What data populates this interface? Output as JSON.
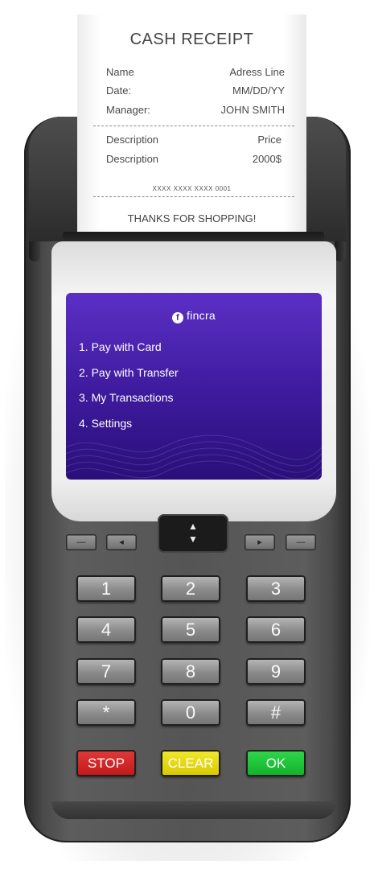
{
  "receipt": {
    "title": "CASH RECEIPT",
    "rows": [
      {
        "label": "Name",
        "value": "Adress Line"
      },
      {
        "label": "Date:",
        "value": "MM/DD/YY"
      },
      {
        "label": "Manager:",
        "value": "JOHN SMITH"
      }
    ],
    "items": [
      {
        "label": "Description",
        "value": "Price"
      },
      {
        "label": "Description",
        "value": "2000$"
      }
    ],
    "card_number": "XXXX XXXX XXXX 0001",
    "thanks": "THANKS FOR SHOPPING!"
  },
  "screen": {
    "brand": "fincra",
    "brand_mark": "f",
    "menu": [
      {
        "label": "1. Pay with Card"
      },
      {
        "label": "2. Pay with Transfer"
      },
      {
        "label": "3. My Transactions"
      },
      {
        "label": "4. Settings"
      }
    ]
  },
  "nav": {
    "up_icon": "▲",
    "down_icon": "▼",
    "left_minus": "—",
    "left_arrow": "◂",
    "right_arrow": "▸",
    "right_minus": "—"
  },
  "keypad": {
    "rows": [
      [
        "1",
        "2",
        "3"
      ],
      [
        "4",
        "5",
        "6"
      ],
      [
        "7",
        "8",
        "9"
      ],
      [
        "*",
        "0",
        "#"
      ]
    ],
    "stop": "STOP",
    "clear": "CLEAR",
    "ok": "OK"
  },
  "colors": {
    "screen_top": "#5b2fc5",
    "screen_bottom": "#2a0f7a",
    "stop": "#d62828",
    "clear": "#e6da10",
    "ok": "#1fc53a"
  }
}
